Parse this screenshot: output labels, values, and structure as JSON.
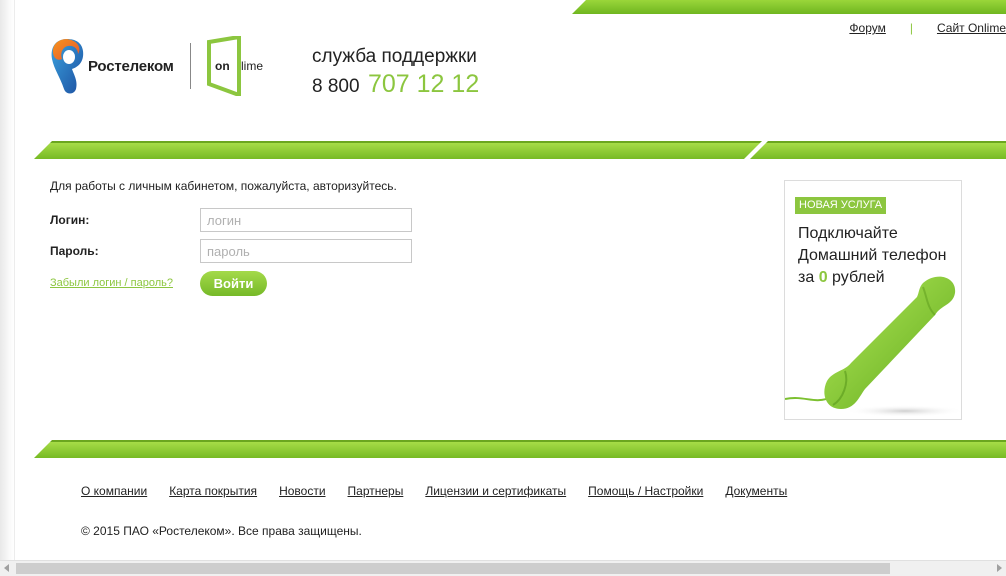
{
  "header": {
    "top_links": [
      {
        "label": "Форум"
      },
      {
        "label": "Сайт Onlime"
      }
    ],
    "separator": "|",
    "logo": {
      "rostelecom_text": "Ростелеком",
      "onlime_on": "on",
      "onlime_lime": "lime"
    },
    "support": {
      "title": "служба поддержки",
      "phone_prefix": "8 800",
      "phone_number": "707 12 12"
    }
  },
  "login": {
    "intro": "Для работы с личным кабинетом, пожалуйста, авторизуйтесь.",
    "login_label": "Логин:",
    "login_placeholder": "логин",
    "login_value": "",
    "password_label": "Пароль:",
    "password_placeholder": "пароль",
    "password_value": "",
    "forgot_link": "Забыли логин / пароль?",
    "submit_label": "Войти"
  },
  "promo": {
    "badge": "НОВАЯ УСЛУГА",
    "line1": "Подключайте",
    "line2": "Домашний телефон",
    "line3_pre": "за ",
    "line3_accent": "0",
    "line3_post": " рублей"
  },
  "footer": {
    "links": [
      {
        "label": "О компании"
      },
      {
        "label": "Карта покрытия"
      },
      {
        "label": "Новости"
      },
      {
        "label": "Партнеры"
      },
      {
        "label": "Лицензии и сертификаты"
      },
      {
        "label": "Помощь / Настройки"
      },
      {
        "label": "Документы"
      }
    ],
    "copyright": "© 2015 ПАО «Ростелеком». Все права защищены."
  },
  "colors": {
    "accent_green": "#8cc63f",
    "rostelecom_orange": "#f36f21",
    "rostelecom_blue": "#1d6fb8"
  }
}
